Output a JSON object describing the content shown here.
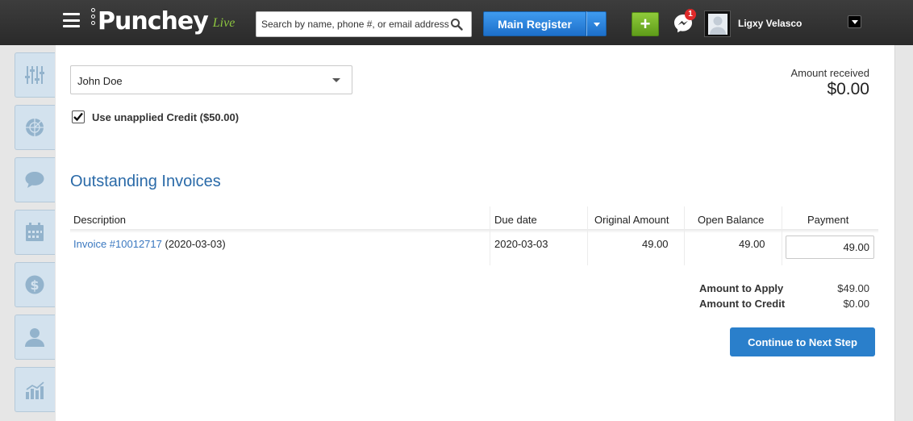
{
  "header": {
    "logo_text": "Punchey",
    "logo_suffix": "Live",
    "search_placeholder": "Search by name, phone #, or email address",
    "register_label": "Main Register",
    "plus_label": "+",
    "notification_count": "1",
    "user_name": "Ligxy Velasco"
  },
  "sidebar": {
    "items": [
      {
        "icon": "sliders-icon"
      },
      {
        "icon": "radar-icon"
      },
      {
        "icon": "chat-icon"
      },
      {
        "icon": "calendar-icon"
      },
      {
        "icon": "dollar-icon"
      },
      {
        "icon": "user-icon"
      },
      {
        "icon": "chart-icon"
      }
    ]
  },
  "form": {
    "customer": "John Doe",
    "use_credit_label": "Use unapplied Credit ($50.00)",
    "use_credit_checked": true,
    "amount_received_label": "Amount received",
    "amount_received_value": "$0.00"
  },
  "invoices": {
    "title": "Outstanding Invoices",
    "columns": [
      "Description",
      "Due date",
      "Original Amount",
      "Open Balance",
      "Payment"
    ],
    "rows": [
      {
        "invoice_link": "Invoice #10012717",
        "invoice_date": "(2020-03-03)",
        "due_date": "2020-03-03",
        "original_amount": "49.00",
        "open_balance": "49.00",
        "payment": "49.00"
      }
    ]
  },
  "summary": {
    "apply_label": "Amount to Apply",
    "apply_value": "$49.00",
    "credit_label": "Amount to Credit",
    "credit_value": "$0.00"
  },
  "actions": {
    "continue_label": "Continue to Next Step"
  },
  "colors": {
    "accent_blue": "#2a7fcb",
    "title_blue": "#2a6aa8",
    "link_blue": "#3a78c0",
    "green": "#6aab22",
    "topbar": "#333333"
  }
}
